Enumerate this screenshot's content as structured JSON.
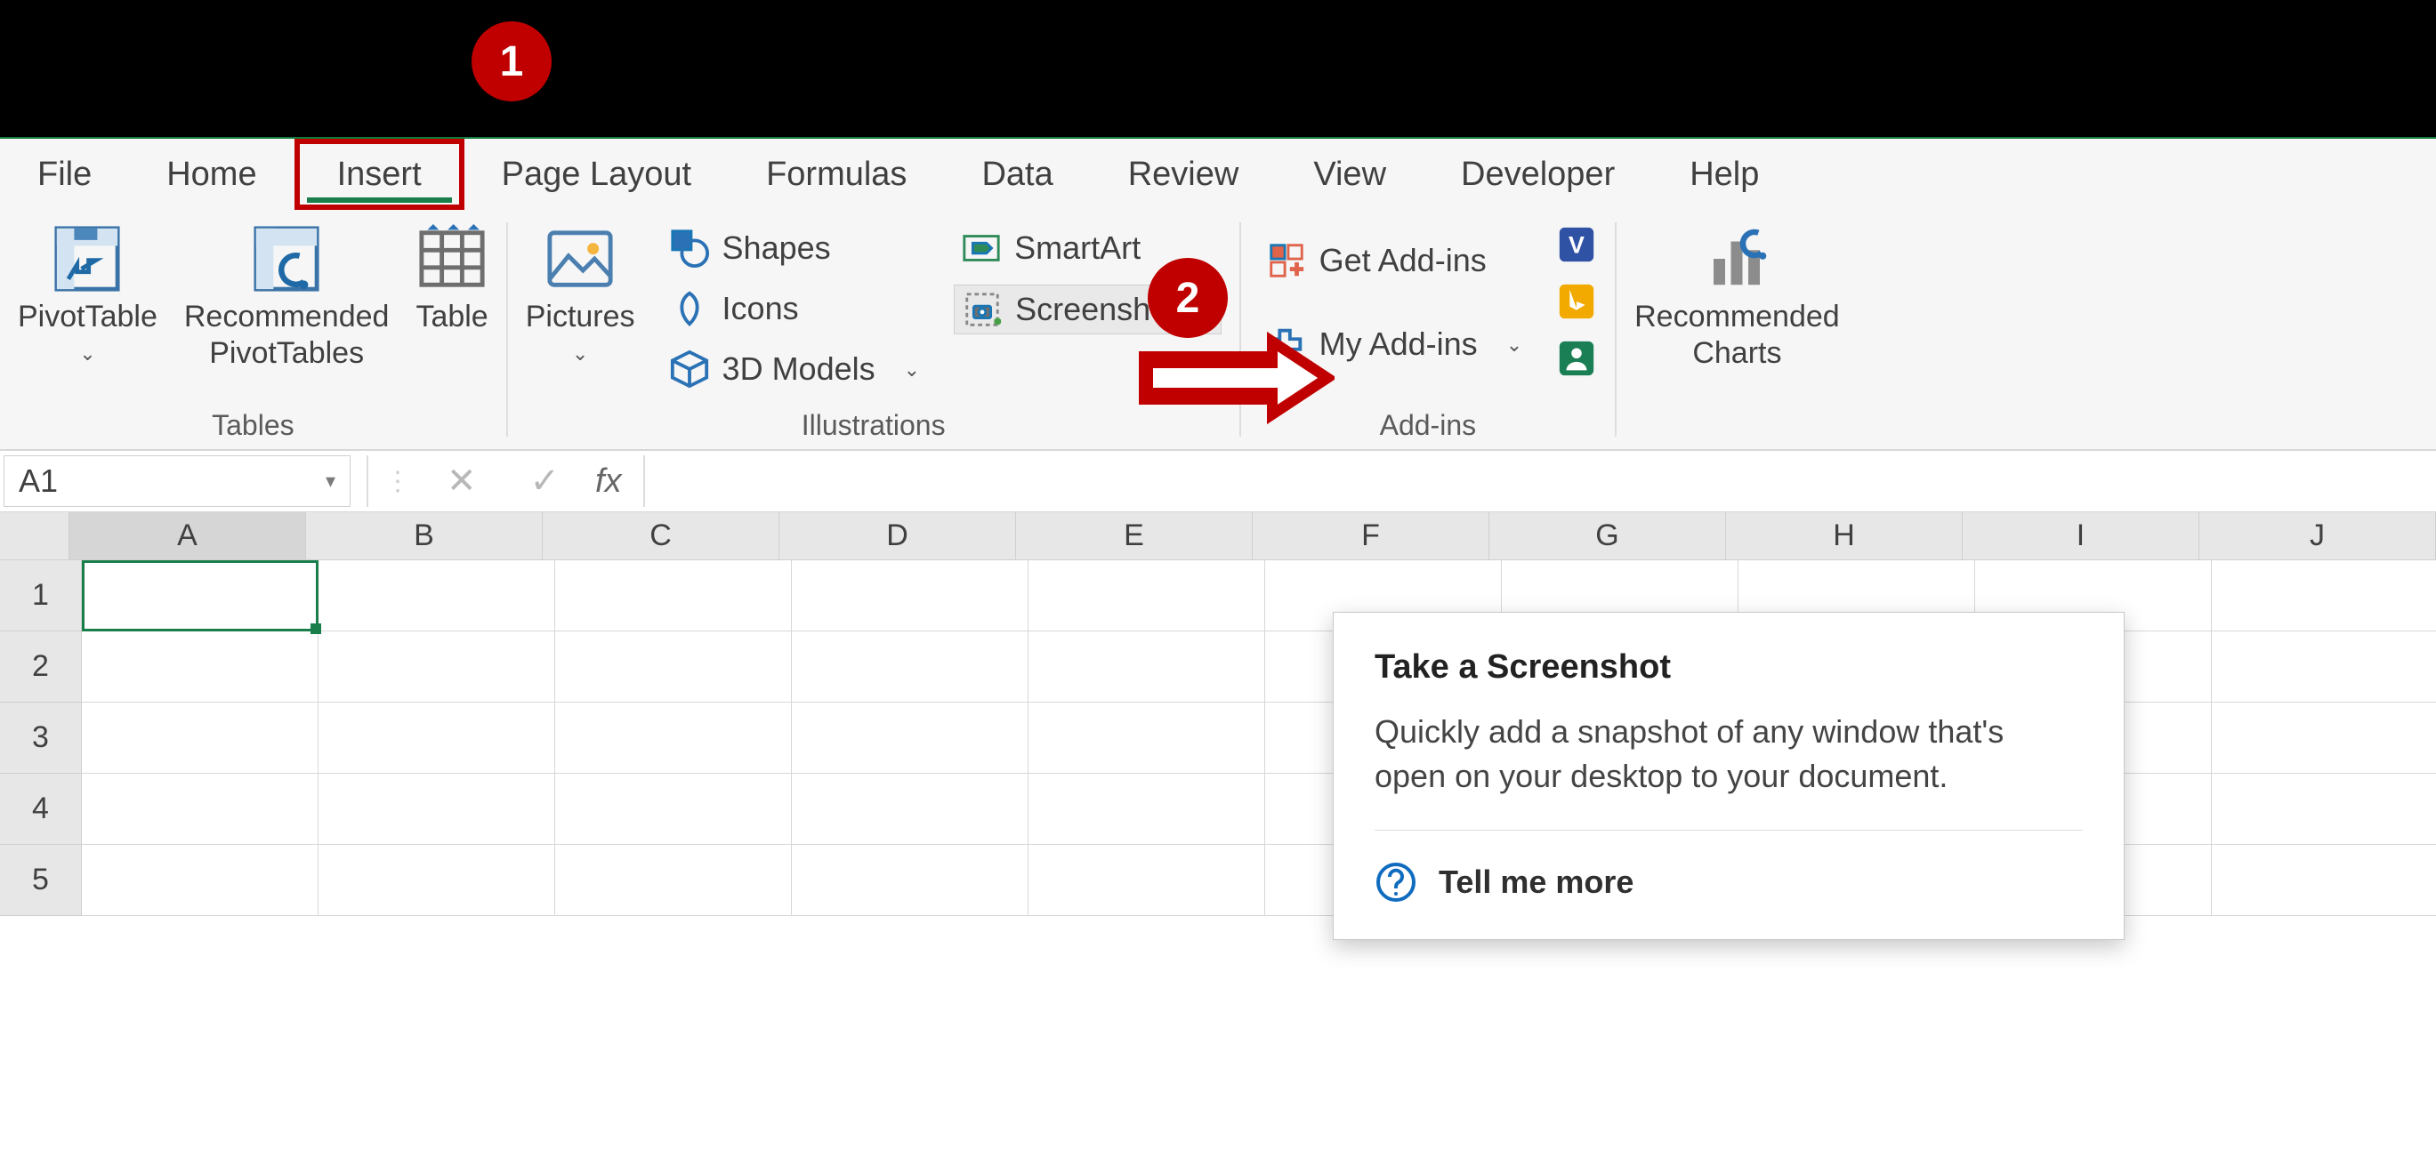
{
  "tabs": {
    "file": "File",
    "home": "Home",
    "insert": "Insert",
    "page_layout": "Page Layout",
    "formulas": "Formulas",
    "data": "Data",
    "review": "Review",
    "view": "View",
    "developer": "Developer",
    "help": "Help"
  },
  "ribbon": {
    "tables": {
      "label": "Tables",
      "pivot": "PivotTable",
      "rec_pivot": "Recommended\nPivotTables",
      "table": "Table"
    },
    "illus": {
      "label": "Illustrations",
      "pictures": "Pictures",
      "shapes": "Shapes",
      "icons": "Icons",
      "models": "3D Models",
      "smartart": "SmartArt",
      "screenshot": "Screenshot"
    },
    "addins": {
      "label": "Add-ins",
      "get": "Get Add-ins",
      "my": "My Add-ins"
    },
    "charts": {
      "rec": "Recommended\nCharts"
    }
  },
  "fbar": {
    "name": "A1",
    "cancel": "✕",
    "enter": "✓",
    "fx": "fx",
    "value": ""
  },
  "grid": {
    "cols": [
      "A",
      "B",
      "C",
      "D",
      "E",
      "F",
      "G",
      "H",
      "I",
      "J"
    ],
    "rows": [
      "1",
      "2",
      "3",
      "4",
      "5"
    ]
  },
  "tooltip": {
    "title": "Take a Screenshot",
    "body": "Quickly add a snapshot of any window that's open on your desktop to your document.",
    "tellme": "Tell me more"
  },
  "anno": {
    "n1": "1",
    "n2": "2"
  }
}
